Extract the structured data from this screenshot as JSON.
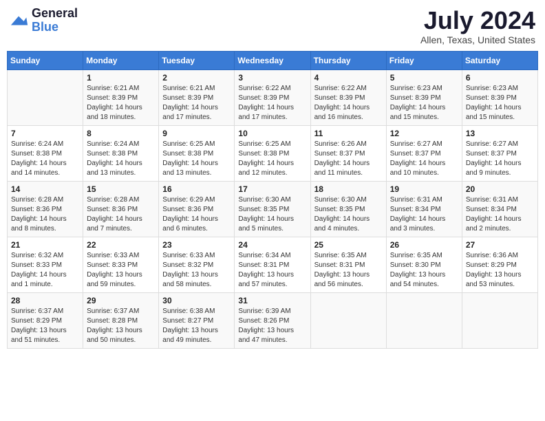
{
  "header": {
    "logo_line1": "General",
    "logo_line2": "Blue",
    "month_year": "July 2024",
    "location": "Allen, Texas, United States"
  },
  "weekdays": [
    "Sunday",
    "Monday",
    "Tuesday",
    "Wednesday",
    "Thursday",
    "Friday",
    "Saturday"
  ],
  "weeks": [
    [
      {
        "day": "",
        "info": ""
      },
      {
        "day": "1",
        "info": "Sunrise: 6:21 AM\nSunset: 8:39 PM\nDaylight: 14 hours\nand 18 minutes."
      },
      {
        "day": "2",
        "info": "Sunrise: 6:21 AM\nSunset: 8:39 PM\nDaylight: 14 hours\nand 17 minutes."
      },
      {
        "day": "3",
        "info": "Sunrise: 6:22 AM\nSunset: 8:39 PM\nDaylight: 14 hours\nand 17 minutes."
      },
      {
        "day": "4",
        "info": "Sunrise: 6:22 AM\nSunset: 8:39 PM\nDaylight: 14 hours\nand 16 minutes."
      },
      {
        "day": "5",
        "info": "Sunrise: 6:23 AM\nSunset: 8:39 PM\nDaylight: 14 hours\nand 15 minutes."
      },
      {
        "day": "6",
        "info": "Sunrise: 6:23 AM\nSunset: 8:39 PM\nDaylight: 14 hours\nand 15 minutes."
      }
    ],
    [
      {
        "day": "7",
        "info": "Sunrise: 6:24 AM\nSunset: 8:38 PM\nDaylight: 14 hours\nand 14 minutes."
      },
      {
        "day": "8",
        "info": "Sunrise: 6:24 AM\nSunset: 8:38 PM\nDaylight: 14 hours\nand 13 minutes."
      },
      {
        "day": "9",
        "info": "Sunrise: 6:25 AM\nSunset: 8:38 PM\nDaylight: 14 hours\nand 13 minutes."
      },
      {
        "day": "10",
        "info": "Sunrise: 6:25 AM\nSunset: 8:38 PM\nDaylight: 14 hours\nand 12 minutes."
      },
      {
        "day": "11",
        "info": "Sunrise: 6:26 AM\nSunset: 8:37 PM\nDaylight: 14 hours\nand 11 minutes."
      },
      {
        "day": "12",
        "info": "Sunrise: 6:27 AM\nSunset: 8:37 PM\nDaylight: 14 hours\nand 10 minutes."
      },
      {
        "day": "13",
        "info": "Sunrise: 6:27 AM\nSunset: 8:37 PM\nDaylight: 14 hours\nand 9 minutes."
      }
    ],
    [
      {
        "day": "14",
        "info": "Sunrise: 6:28 AM\nSunset: 8:36 PM\nDaylight: 14 hours\nand 8 minutes."
      },
      {
        "day": "15",
        "info": "Sunrise: 6:28 AM\nSunset: 8:36 PM\nDaylight: 14 hours\nand 7 minutes."
      },
      {
        "day": "16",
        "info": "Sunrise: 6:29 AM\nSunset: 8:36 PM\nDaylight: 14 hours\nand 6 minutes."
      },
      {
        "day": "17",
        "info": "Sunrise: 6:30 AM\nSunset: 8:35 PM\nDaylight: 14 hours\nand 5 minutes."
      },
      {
        "day": "18",
        "info": "Sunrise: 6:30 AM\nSunset: 8:35 PM\nDaylight: 14 hours\nand 4 minutes."
      },
      {
        "day": "19",
        "info": "Sunrise: 6:31 AM\nSunset: 8:34 PM\nDaylight: 14 hours\nand 3 minutes."
      },
      {
        "day": "20",
        "info": "Sunrise: 6:31 AM\nSunset: 8:34 PM\nDaylight: 14 hours\nand 2 minutes."
      }
    ],
    [
      {
        "day": "21",
        "info": "Sunrise: 6:32 AM\nSunset: 8:33 PM\nDaylight: 14 hours\nand 1 minute."
      },
      {
        "day": "22",
        "info": "Sunrise: 6:33 AM\nSunset: 8:33 PM\nDaylight: 13 hours\nand 59 minutes."
      },
      {
        "day": "23",
        "info": "Sunrise: 6:33 AM\nSunset: 8:32 PM\nDaylight: 13 hours\nand 58 minutes."
      },
      {
        "day": "24",
        "info": "Sunrise: 6:34 AM\nSunset: 8:31 PM\nDaylight: 13 hours\nand 57 minutes."
      },
      {
        "day": "25",
        "info": "Sunrise: 6:35 AM\nSunset: 8:31 PM\nDaylight: 13 hours\nand 56 minutes."
      },
      {
        "day": "26",
        "info": "Sunrise: 6:35 AM\nSunset: 8:30 PM\nDaylight: 13 hours\nand 54 minutes."
      },
      {
        "day": "27",
        "info": "Sunrise: 6:36 AM\nSunset: 8:29 PM\nDaylight: 13 hours\nand 53 minutes."
      }
    ],
    [
      {
        "day": "28",
        "info": "Sunrise: 6:37 AM\nSunset: 8:29 PM\nDaylight: 13 hours\nand 51 minutes."
      },
      {
        "day": "29",
        "info": "Sunrise: 6:37 AM\nSunset: 8:28 PM\nDaylight: 13 hours\nand 50 minutes."
      },
      {
        "day": "30",
        "info": "Sunrise: 6:38 AM\nSunset: 8:27 PM\nDaylight: 13 hours\nand 49 minutes."
      },
      {
        "day": "31",
        "info": "Sunrise: 6:39 AM\nSunset: 8:26 PM\nDaylight: 13 hours\nand 47 minutes."
      },
      {
        "day": "",
        "info": ""
      },
      {
        "day": "",
        "info": ""
      },
      {
        "day": "",
        "info": ""
      }
    ]
  ]
}
